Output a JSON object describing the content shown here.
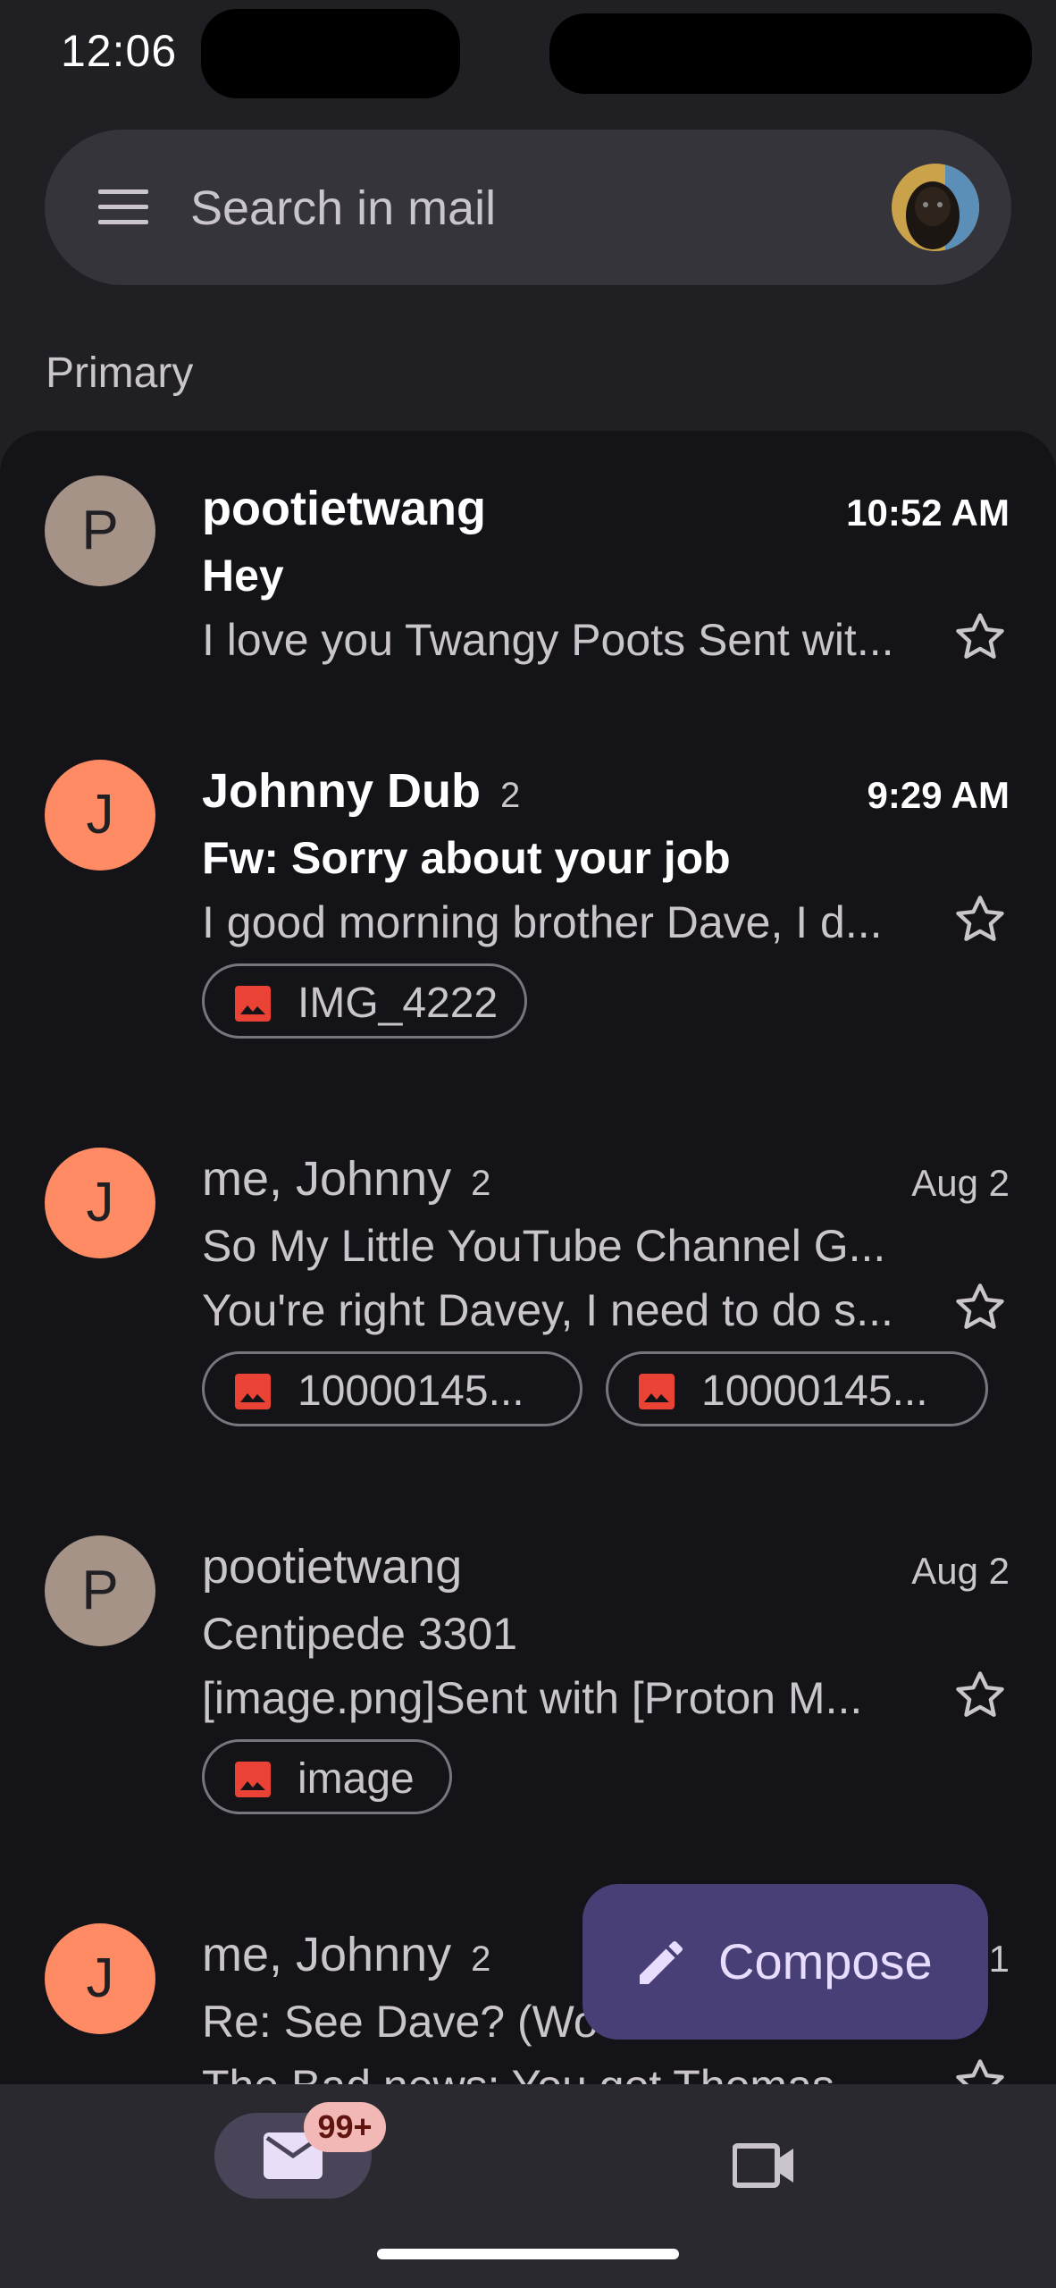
{
  "status_bar": {
    "time": "12:06"
  },
  "search": {
    "placeholder": "Search in mail"
  },
  "section": {
    "label": "Primary"
  },
  "emails": [
    {
      "avatar_letter": "P",
      "avatar_color": "#a69388",
      "sender": "pootietwang",
      "count": "",
      "time": "10:52 AM",
      "subject": "Hey",
      "snippet": "I love you Twangy Poots Sent wit...",
      "unread": true,
      "attachments": []
    },
    {
      "avatar_letter": "J",
      "avatar_color": "#ff8b64",
      "sender": "Johnny Dub",
      "count": "2",
      "time": "9:29 AM",
      "subject": "Fw: Sorry about your job",
      "snippet": "I good morning brother Dave, I d...",
      "unread": true,
      "attachments": [
        "IMG_4222"
      ]
    },
    {
      "avatar_letter": "J",
      "avatar_color": "#ff8b64",
      "sender": "me, Johnny",
      "count": "2",
      "time": "Aug 2",
      "subject": "So My Little YouTube Channel G...",
      "snippet": "You're right Davey, I need to do s...",
      "unread": false,
      "attachments": [
        "10000145...",
        "10000145..."
      ]
    },
    {
      "avatar_letter": "P",
      "avatar_color": "#a69388",
      "sender": "pootietwang",
      "count": "",
      "time": "Aug 2",
      "subject": "Centipede 3301",
      "snippet": "[image.png]Sent with [Proton M...",
      "unread": false,
      "attachments": [
        "image"
      ]
    },
    {
      "avatar_letter": "J",
      "avatar_color": "#ff8b64",
      "sender": "me, Johnny",
      "count": "2",
      "time": "1",
      "subject": "Re: See Dave? (Wo",
      "snippet": "The Bad news: You got Thomas",
      "unread": false,
      "attachments": []
    }
  ],
  "compose": {
    "label": "Compose"
  },
  "bottom_nav": {
    "mail_badge": "99+"
  },
  "colors": {
    "background": "#1f1f24",
    "list_background": "#141318",
    "compose_fab": "#483f77",
    "badge": "#f2b8b5",
    "attachment_icon": "#ea4335"
  },
  "icons": [
    "menu-icon",
    "star-icon",
    "image-attachment-icon",
    "pencil-icon",
    "mail-icon",
    "video-camera-icon"
  ]
}
